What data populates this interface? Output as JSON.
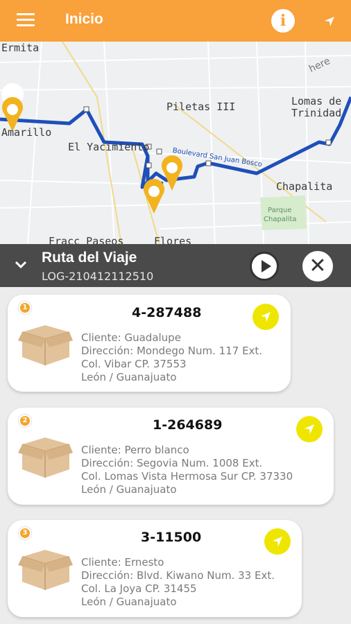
{
  "app_bar": {
    "title": "Inicio",
    "info_glyph": "i"
  },
  "map": {
    "labels": {
      "ermita": "Ermita",
      "piletas": "Piletas III",
      "lomas": "Lomas de",
      "trinidad": "Trinidad",
      "yacimiento": "El Yacimiento",
      "amarillo": "Amarillo",
      "chapalita": "Chapalita",
      "parque1": "Parque",
      "parque2": "Chapalita",
      "fracc": "Fracc Paseos",
      "flores": "Flores",
      "boulevard": "Boulevard San Juan Bosco",
      "here": "here"
    }
  },
  "route": {
    "title": "Ruta del Viaje",
    "code": "LOG-210412112510"
  },
  "deliveries": [
    {
      "seq": "1",
      "id": "4-287488",
      "cliente": "Cliente: Guadalupe",
      "direccion": "Dirección: Mondego Num. 117 Ext.",
      "colonia": "Col. Vibar  CP. 37553",
      "ciudad": "León / Guanajuato"
    },
    {
      "seq": "2",
      "id": "1-264689",
      "cliente": "Cliente: Perro blanco",
      "direccion": "Dirección: Segovia Num. 1008 Ext.",
      "colonia": "Col. Lomas Vista Hermosa Sur  CP. 37330",
      "ciudad": "León / Guanajuato"
    },
    {
      "seq": "3",
      "id": "3-11500",
      "cliente": "Cliente: Ernesto",
      "direccion": "Dirección: Blvd. Kiwano Num. 33 Ext.",
      "colonia": "Col. La Joya  CP. 31455",
      "ciudad": "León / Guanajuato"
    }
  ],
  "colors": {
    "app_bar": "#f9a13a",
    "route_bar": "#4a4a4a",
    "route_line": "#1f4fb8",
    "marker": "#f2b31e",
    "go_button": "#efe600"
  },
  "icons": {
    "menu": "hamburger-icon",
    "info": "info-icon",
    "navigate": "navigation-arrow-icon",
    "collapse": "chevron-down-icon",
    "play": "play-icon",
    "close": "close-icon",
    "package": "package-box-icon"
  }
}
